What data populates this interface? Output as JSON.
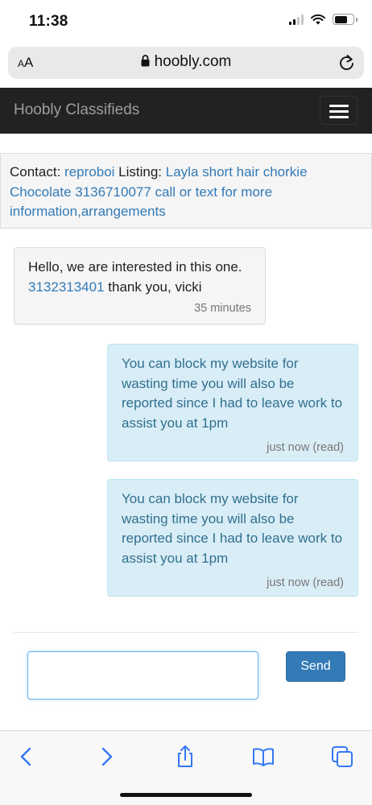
{
  "status_bar": {
    "time": "11:38"
  },
  "browser": {
    "aa_label_small": "A",
    "aa_label_large": "A",
    "url": "hoobly.com"
  },
  "navbar": {
    "brand": "Hoobly Classifieds"
  },
  "contact": {
    "contact_label": "Contact:",
    "contact_user": "reproboi",
    "listing_label": "Listing:",
    "listing_title": "Layla short hair chorkie Chocolate 3136710077 call or text for more information,arrangements"
  },
  "messages": [
    {
      "direction": "incoming",
      "text_before": "Hello, we are interested in this one.",
      "phone": "3132313401",
      "text_after": "thank you, vicki",
      "time": "35 minutes"
    },
    {
      "direction": "outgoing",
      "text": "You can block my website for wasting time you will also be reported since I had to leave work to assist you at 1pm",
      "time": "just now (read)"
    },
    {
      "direction": "outgoing",
      "text": "You can block my website for wasting time you will also be reported since I had to leave work to assist you at 1pm",
      "time": "just now (read)"
    }
  ],
  "reply": {
    "value": "",
    "send_label": "Send"
  },
  "toolbar": {
    "icons": [
      "back-icon",
      "forward-icon",
      "share-icon",
      "bookmarks-icon",
      "tabs-icon"
    ]
  },
  "colors": {
    "navbar_bg": "#222222",
    "link": "#337ab7",
    "outgoing_bg": "#d9edf7",
    "outgoing_text": "#31708f",
    "send_button": "#337ab7"
  }
}
